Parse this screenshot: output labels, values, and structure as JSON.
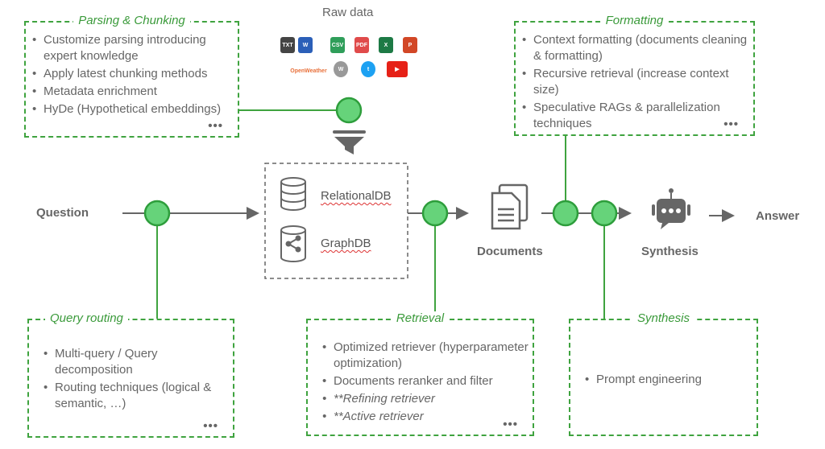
{
  "raw_data": {
    "title": "Raw data",
    "sources": [
      {
        "icon": "txt-file-icon",
        "label": "TXT",
        "color": "#444444"
      },
      {
        "icon": "word-icon",
        "label": "W",
        "color": "#2b5fb8"
      },
      {
        "icon": "csv-file-icon",
        "label": "CSV",
        "color": "#2f9e5a"
      },
      {
        "icon": "pdf-file-icon",
        "label": "PDF",
        "color": "#e04b4b"
      },
      {
        "icon": "excel-icon",
        "label": "X",
        "color": "#1d7a45"
      },
      {
        "icon": "powerpoint-icon",
        "label": "P",
        "color": "#d24726"
      },
      {
        "icon": "openweather-icon",
        "label": "OpenWeather",
        "color": "#e8703a"
      },
      {
        "icon": "wikipedia-icon",
        "label": "W",
        "color": "#999999"
      },
      {
        "icon": "twitter-icon",
        "label": "t",
        "color": "#1da1f2"
      },
      {
        "icon": "youtube-icon",
        "label": "▶",
        "color": "#e62117"
      }
    ]
  },
  "parsing": {
    "title": "Parsing & Chunking",
    "items": [
      "Customize parsing introducing expert knowledge",
      "Apply latest chunking methods",
      "Metadata enrichment",
      "HyDe (Hypothetical embeddings)"
    ],
    "more": "•••"
  },
  "formatting": {
    "title": "Formatting",
    "items": [
      "Context formatting (documents cleaning & formatting)",
      "Recursive retrieval (increase context size)",
      "Speculative RAGs & parallelization techniques"
    ],
    "more": "•••"
  },
  "query_routing": {
    "title": "Query routing",
    "items": [
      "Multi-query / Query decomposition",
      "Routing techniques (logical & semantic, …)"
    ],
    "more": "•••"
  },
  "retrieval": {
    "title": "Retrieval",
    "items": [
      "Optimized retriever (hyperparameter optimization)",
      "Documents reranker and filter",
      "**Refining retriever",
      "**Active retriever"
    ],
    "more": "•••"
  },
  "synthesis_box": {
    "title": "Synthesis",
    "items": [
      "Prompt engineering"
    ]
  },
  "flow": {
    "question": "Question",
    "relational_db": "RelationalDB",
    "graph_db": "GraphDB",
    "documents": "Documents",
    "synthesis": "Synthesis",
    "answer": "Answer"
  },
  "colors": {
    "accent": "#3fa33f",
    "node_fill": "#66d37a",
    "text": "#666666"
  }
}
